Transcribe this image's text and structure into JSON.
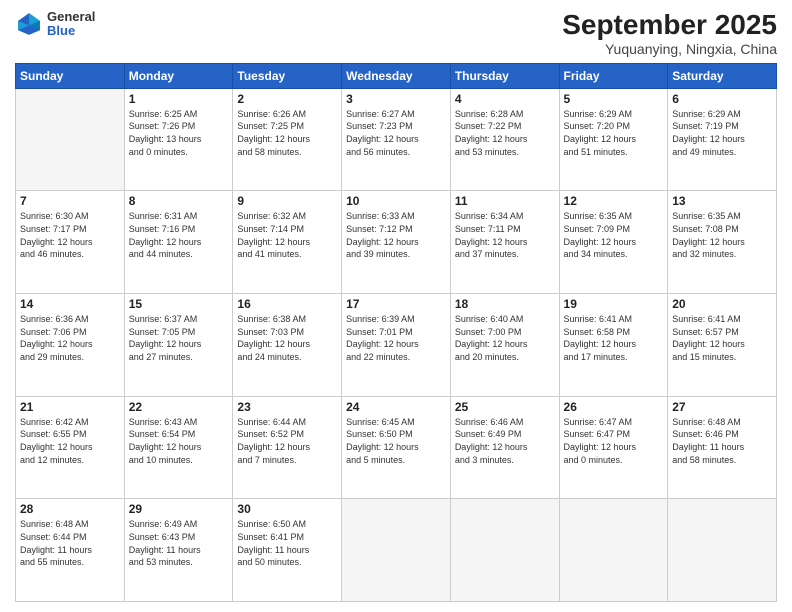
{
  "header": {
    "logo": {
      "line1": "General",
      "line2": "Blue"
    },
    "title": "September 2025",
    "subtitle": "Yuquanying, Ningxia, China"
  },
  "days_of_week": [
    "Sunday",
    "Monday",
    "Tuesday",
    "Wednesday",
    "Thursday",
    "Friday",
    "Saturday"
  ],
  "weeks": [
    [
      {
        "day": "",
        "info": ""
      },
      {
        "day": "1",
        "info": "Sunrise: 6:25 AM\nSunset: 7:26 PM\nDaylight: 13 hours\nand 0 minutes."
      },
      {
        "day": "2",
        "info": "Sunrise: 6:26 AM\nSunset: 7:25 PM\nDaylight: 12 hours\nand 58 minutes."
      },
      {
        "day": "3",
        "info": "Sunrise: 6:27 AM\nSunset: 7:23 PM\nDaylight: 12 hours\nand 56 minutes."
      },
      {
        "day": "4",
        "info": "Sunrise: 6:28 AM\nSunset: 7:22 PM\nDaylight: 12 hours\nand 53 minutes."
      },
      {
        "day": "5",
        "info": "Sunrise: 6:29 AM\nSunset: 7:20 PM\nDaylight: 12 hours\nand 51 minutes."
      },
      {
        "day": "6",
        "info": "Sunrise: 6:29 AM\nSunset: 7:19 PM\nDaylight: 12 hours\nand 49 minutes."
      }
    ],
    [
      {
        "day": "7",
        "info": "Sunrise: 6:30 AM\nSunset: 7:17 PM\nDaylight: 12 hours\nand 46 minutes."
      },
      {
        "day": "8",
        "info": "Sunrise: 6:31 AM\nSunset: 7:16 PM\nDaylight: 12 hours\nand 44 minutes."
      },
      {
        "day": "9",
        "info": "Sunrise: 6:32 AM\nSunset: 7:14 PM\nDaylight: 12 hours\nand 41 minutes."
      },
      {
        "day": "10",
        "info": "Sunrise: 6:33 AM\nSunset: 7:12 PM\nDaylight: 12 hours\nand 39 minutes."
      },
      {
        "day": "11",
        "info": "Sunrise: 6:34 AM\nSunset: 7:11 PM\nDaylight: 12 hours\nand 37 minutes."
      },
      {
        "day": "12",
        "info": "Sunrise: 6:35 AM\nSunset: 7:09 PM\nDaylight: 12 hours\nand 34 minutes."
      },
      {
        "day": "13",
        "info": "Sunrise: 6:35 AM\nSunset: 7:08 PM\nDaylight: 12 hours\nand 32 minutes."
      }
    ],
    [
      {
        "day": "14",
        "info": "Sunrise: 6:36 AM\nSunset: 7:06 PM\nDaylight: 12 hours\nand 29 minutes."
      },
      {
        "day": "15",
        "info": "Sunrise: 6:37 AM\nSunset: 7:05 PM\nDaylight: 12 hours\nand 27 minutes."
      },
      {
        "day": "16",
        "info": "Sunrise: 6:38 AM\nSunset: 7:03 PM\nDaylight: 12 hours\nand 24 minutes."
      },
      {
        "day": "17",
        "info": "Sunrise: 6:39 AM\nSunset: 7:01 PM\nDaylight: 12 hours\nand 22 minutes."
      },
      {
        "day": "18",
        "info": "Sunrise: 6:40 AM\nSunset: 7:00 PM\nDaylight: 12 hours\nand 20 minutes."
      },
      {
        "day": "19",
        "info": "Sunrise: 6:41 AM\nSunset: 6:58 PM\nDaylight: 12 hours\nand 17 minutes."
      },
      {
        "day": "20",
        "info": "Sunrise: 6:41 AM\nSunset: 6:57 PM\nDaylight: 12 hours\nand 15 minutes."
      }
    ],
    [
      {
        "day": "21",
        "info": "Sunrise: 6:42 AM\nSunset: 6:55 PM\nDaylight: 12 hours\nand 12 minutes."
      },
      {
        "day": "22",
        "info": "Sunrise: 6:43 AM\nSunset: 6:54 PM\nDaylight: 12 hours\nand 10 minutes."
      },
      {
        "day": "23",
        "info": "Sunrise: 6:44 AM\nSunset: 6:52 PM\nDaylight: 12 hours\nand 7 minutes."
      },
      {
        "day": "24",
        "info": "Sunrise: 6:45 AM\nSunset: 6:50 PM\nDaylight: 12 hours\nand 5 minutes."
      },
      {
        "day": "25",
        "info": "Sunrise: 6:46 AM\nSunset: 6:49 PM\nDaylight: 12 hours\nand 3 minutes."
      },
      {
        "day": "26",
        "info": "Sunrise: 6:47 AM\nSunset: 6:47 PM\nDaylight: 12 hours\nand 0 minutes."
      },
      {
        "day": "27",
        "info": "Sunrise: 6:48 AM\nSunset: 6:46 PM\nDaylight: 11 hours\nand 58 minutes."
      }
    ],
    [
      {
        "day": "28",
        "info": "Sunrise: 6:48 AM\nSunset: 6:44 PM\nDaylight: 11 hours\nand 55 minutes."
      },
      {
        "day": "29",
        "info": "Sunrise: 6:49 AM\nSunset: 6:43 PM\nDaylight: 11 hours\nand 53 minutes."
      },
      {
        "day": "30",
        "info": "Sunrise: 6:50 AM\nSunset: 6:41 PM\nDaylight: 11 hours\nand 50 minutes."
      },
      {
        "day": "",
        "info": ""
      },
      {
        "day": "",
        "info": ""
      },
      {
        "day": "",
        "info": ""
      },
      {
        "day": "",
        "info": ""
      }
    ]
  ]
}
